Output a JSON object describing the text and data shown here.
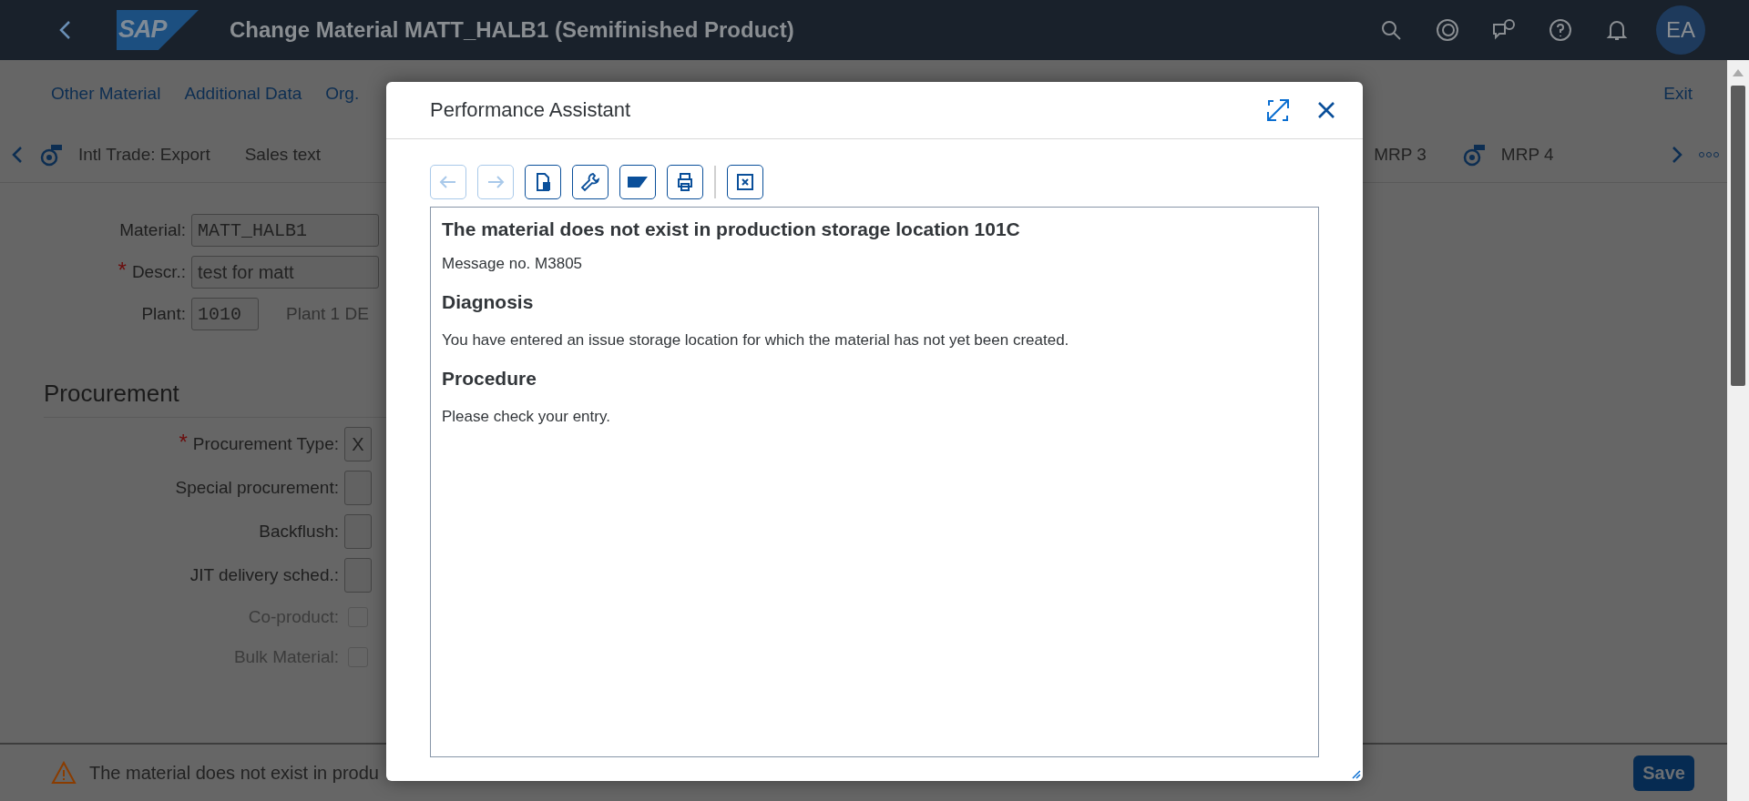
{
  "required_symbol": "*",
  "shell": {
    "logo": "SAP",
    "title": "Change Material MATT_HALB1 (Semifinished Product)",
    "avatar": "EA"
  },
  "menu": {
    "links": [
      "Other Material",
      "Additional Data",
      "Org."
    ],
    "exit": "Exit"
  },
  "tabs": [
    {
      "label": "Intl Trade: Export",
      "kind": "icon"
    },
    {
      "label": "Sales text",
      "kind": "plain"
    },
    {
      "label": "MRP 3",
      "kind": "plain"
    },
    {
      "label": "MRP 4",
      "kind": "icon"
    }
  ],
  "header_fields": [
    {
      "label": "Material:",
      "value": "MATT_HALB1",
      "required": false,
      "kind": "mono"
    },
    {
      "label": "Descr.:",
      "value": "test for matt",
      "required": true,
      "kind": "text"
    },
    {
      "label": "Plant:",
      "value": "1010",
      "required": false,
      "kind": "short",
      "note": "Plant 1 DE"
    }
  ],
  "procurement": {
    "title": "Procurement",
    "rows": [
      {
        "label": "Procurement Type:",
        "required": true,
        "kind": "input",
        "value": "X",
        "disabled": false
      },
      {
        "label": "Special procurement:",
        "required": false,
        "kind": "input",
        "disabled": false
      },
      {
        "label": "Backflush:",
        "required": false,
        "kind": "input",
        "disabled": false
      },
      {
        "label": "JIT delivery sched.:",
        "required": false,
        "kind": "input",
        "disabled": false
      },
      {
        "label": "Co-product:",
        "required": false,
        "kind": "checkbox",
        "checked": false,
        "disabled": true
      },
      {
        "label": "Bulk Material:",
        "required": false,
        "kind": "checkbox",
        "checked": false,
        "disabled": true
      }
    ]
  },
  "dialog": {
    "title": "Performance Assistant",
    "tools": [
      {
        "kind": "back",
        "disabled": true
      },
      {
        "kind": "forward",
        "disabled": true
      },
      {
        "kind": "document",
        "disabled": false
      },
      {
        "kind": "wrench",
        "disabled": false
      },
      {
        "kind": "logo",
        "disabled": false
      },
      {
        "kind": "print",
        "disabled": false
      },
      {
        "kind": "separator"
      },
      {
        "kind": "close",
        "disabled": false
      }
    ],
    "heading": "The material does not exist in production storage location 101C",
    "message_no": "Message no. M3805",
    "sections": [
      {
        "title": "Diagnosis",
        "text": "You have entered an issue storage location for which the material has not yet been created."
      },
      {
        "title": "Procedure",
        "text": "Please check your entry."
      }
    ]
  },
  "status": {
    "message": "The material does not exist in produ",
    "save": "Save"
  }
}
